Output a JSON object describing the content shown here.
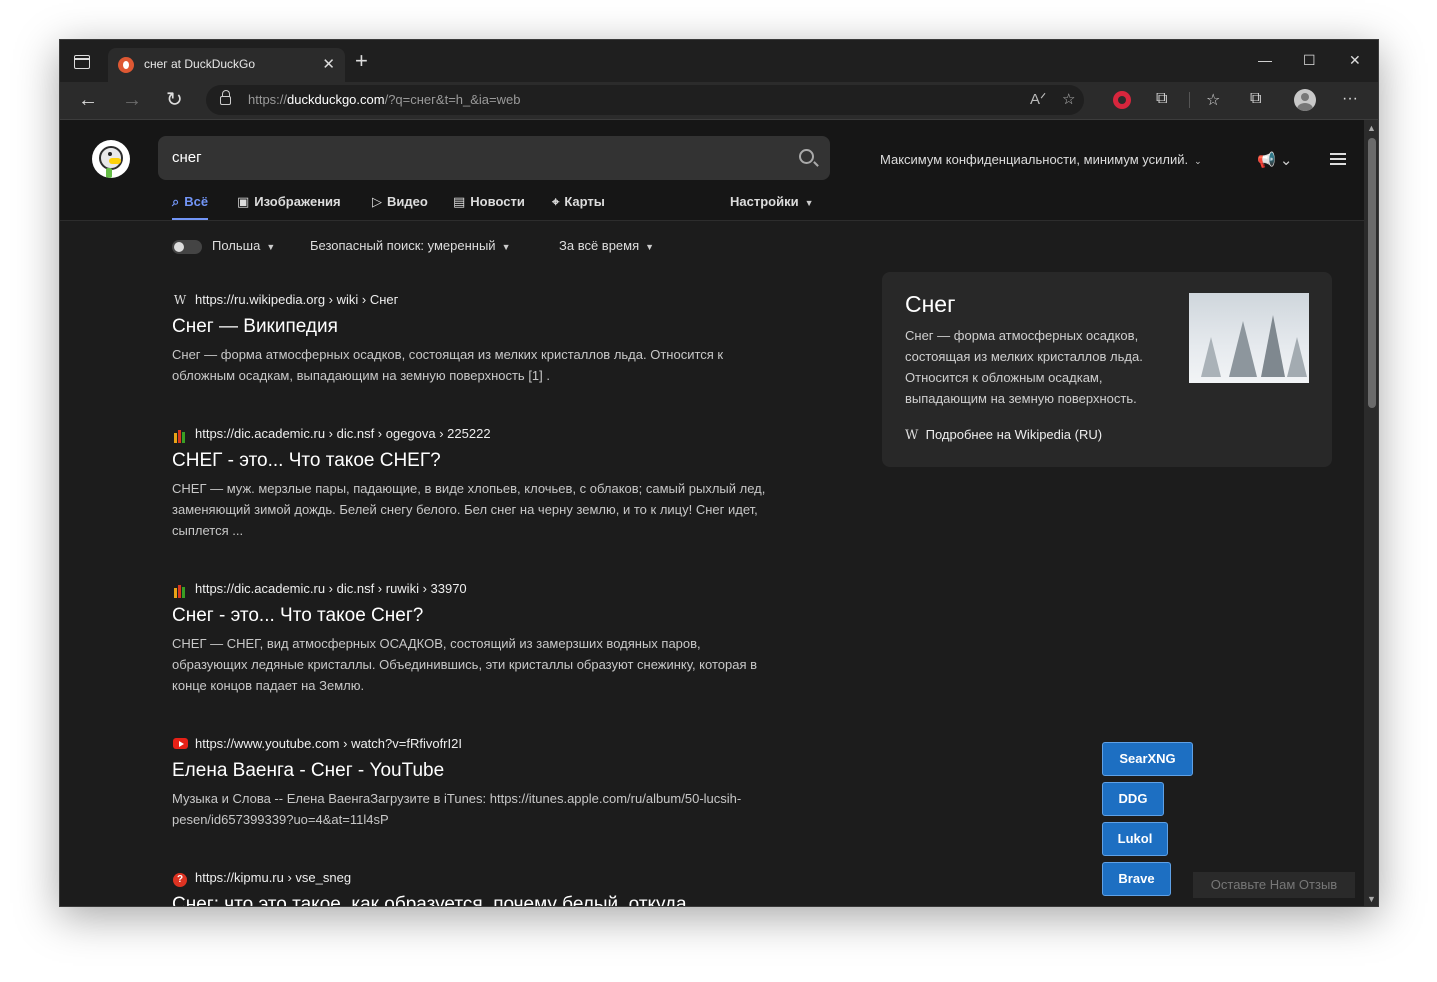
{
  "browser": {
    "tab_title": "снег at DuckDuckGo",
    "url_prefix": "https://",
    "url_host": "duckduckgo.com",
    "url_path": "/?q=снег&t=h_&ia=web",
    "window_controls": [
      "—",
      "☐",
      "✕"
    ]
  },
  "header": {
    "search_value": "снег",
    "privacy_label": "Максимум конфиденциальности, минимум усилий.",
    "tabs": [
      {
        "label": "Всё",
        "icon": "search-icon"
      },
      {
        "label": "Изображения",
        "icon": "image-icon"
      },
      {
        "label": "Видео",
        "icon": "play-icon"
      },
      {
        "label": "Новости",
        "icon": "news-icon"
      },
      {
        "label": "Карты",
        "icon": "map-pin-icon"
      }
    ],
    "settings_label": "Настройки"
  },
  "filters": {
    "region": "Польша",
    "safe_search": "Безопасный поиск: умеренный",
    "time": "За всё время"
  },
  "results": [
    {
      "favicon": "wikipedia-icon",
      "url": "https://ru.wikipedia.org › wiki › Снег",
      "title": "Снег — Википедия",
      "snippet_bold": "",
      "snippet": "Снег — форма атмосферных осадков, состоящая из мелких кристаллов льда. Относится к обложным осадкам, выпадающим на земную поверхность [1] ."
    },
    {
      "favicon": "academic-icon",
      "url": "https://dic.academic.ru › dic.nsf › ogegova › 225222",
      "title": "СНЕГ - это... Что такое СНЕГ?",
      "snippet": "СНЕГ — муж. мерзлые пары, падающие, в виде хлопьев, клочьев, с облаков; самый рыхлый лед, заменяющий зимой дождь. Белей снегу белого. Бел снег на черну землю, и то к лицу! Снег идет, сыплется ..."
    },
    {
      "favicon": "academic-icon",
      "url": "https://dic.academic.ru › dic.nsf › ruwiki › 33970",
      "title": "Снег - это... Что такое Снег?",
      "snippet": "СНЕГ — СНЕГ, вид атмосферных ОСАДКОВ, состоящий из замерзших водяных паров, образующих ледяные кристаллы. Объединившись, эти кристаллы образуют снежинку, которая в конце концов падает на Землю."
    },
    {
      "favicon": "youtube-icon",
      "url": "https://www.youtube.com › watch?v=fRfivofrI2I",
      "title": "Елена Ваенга - Снег - YouTube",
      "snippet": "Музыка и Слова -- Елена ВаенгаЗагрузите в iTunes: https://itunes.apple.com/ru/album/50-lucsih-pesen/id657399339?uo=4&at=11l4sP"
    },
    {
      "favicon": "kipmu-icon",
      "url": "https://kipmu.ru › vse_sneg",
      "title": "Снег: что это такое, как образуется, почему белый, откуда",
      "snippet": ""
    }
  ],
  "knowledge_panel": {
    "title": "Снег",
    "text": "Снег — форма атмосферных осадков, состоящая из мелких кристаллов льда. Относится к обложным осадкам, выпадающим на земную поверхность.",
    "more_label": "Подробнее на Wikipedia (RU)"
  },
  "engine_buttons": [
    "SearXNG",
    "DDG",
    "Lukol",
    "Brave"
  ],
  "feedback_label": "Оставьте Нам Отзыв"
}
